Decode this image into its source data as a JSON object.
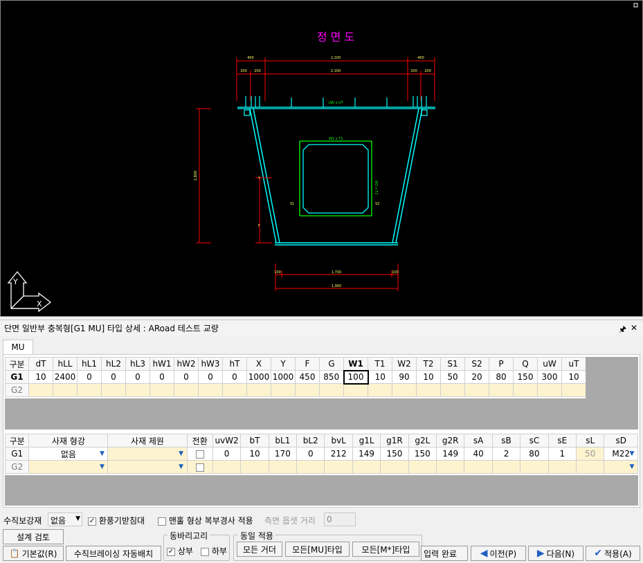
{
  "drawing": {
    "title": "정 면 도",
    "dims": {
      "top_left": "400",
      "top_mid": "2,100",
      "top_right": "400",
      "sub_left1": "200",
      "sub_left2": "200",
      "sub_mid": "2,100",
      "sub_right1": "200",
      "sub_right2": "200",
      "uw_ut": "UW x UT",
      "w1_t1": "W1 x T1",
      "w2_t2": "W2 x T2",
      "height": "2,800",
      "y": "Y",
      "f": "F",
      "s1": "S1",
      "s2": "S2",
      "bottom_inner": "1,700",
      "bottom_outer": "1,900",
      "bot_left": "100",
      "bot_right": "100"
    },
    "axis_y": "Y",
    "axis_x": "X",
    "colors": {
      "background": "#000000",
      "title": "#ff00ff",
      "dimension": "#ff0000",
      "girder": "#00ffff",
      "stiffener": "#00ff00",
      "text_dim": "#ffff00"
    }
  },
  "panel": {
    "title": "단면 일반부 충복형[G1 MU] 타입 상세 : ARoad 테스트 교량",
    "pin_icon": "pin-icon",
    "close_icon": "close-icon"
  },
  "tabs": {
    "mu": "MU"
  },
  "grid1": {
    "headers": [
      "구분",
      "dT",
      "hLL",
      "hL1",
      "hL2",
      "hL3",
      "hW1",
      "hW2",
      "hW3",
      "hT",
      "X",
      "Y",
      "F",
      "G",
      "W1",
      "T1",
      "W2",
      "T2",
      "S1",
      "S2",
      "P",
      "Q",
      "uW",
      "uT"
    ],
    "g1": [
      "G1",
      "10",
      "2400",
      "0",
      "0",
      "0",
      "0",
      "0",
      "0",
      "0",
      "1000",
      "1000",
      "450",
      "850",
      "100",
      "10",
      "90",
      "10",
      "50",
      "20",
      "80",
      "150",
      "300",
      "10"
    ],
    "g2": [
      "G2",
      "",
      "",
      "",
      "",
      "",
      "",
      "",
      "",
      "",
      "",
      "",
      "",
      "",
      "",
      "",
      "",
      "",
      "",
      "",
      "",
      "",
      "",
      ""
    ]
  },
  "grid2": {
    "headers": [
      "구분",
      "사재 형강",
      "사재 제원",
      "전환",
      "uvW2",
      "bT",
      "bL1",
      "bL2",
      "bvL",
      "g1L",
      "g1R",
      "g2L",
      "g2R",
      "sA",
      "sB",
      "sC",
      "sE",
      "sL",
      "sD"
    ],
    "g1": [
      "G1",
      "없음",
      "",
      "",
      "0",
      "10",
      "170",
      "0",
      "212",
      "149",
      "150",
      "150",
      "149",
      "40",
      "2",
      "80",
      "1",
      "50",
      "M22"
    ],
    "g2": [
      "G2",
      "",
      "",
      "",
      "",
      "",
      "",
      "",
      "",
      "",
      "",
      "",
      "",
      "",
      "",
      "",
      "",
      "",
      ""
    ]
  },
  "options": {
    "vertical_stiffener_label": "수직보강재",
    "vertical_stiffener_value": "없음",
    "eco_bearing_label": "환풍기받침대",
    "eco_bearing_checked": true,
    "hole_label": "맨홀 형상 복부경사 적용",
    "hole_checked": false,
    "side_offset_label": "측면 옵셋 거리",
    "side_offset_value": "0"
  },
  "buttons": {
    "design_review": "설계 검토",
    "defaults": "기본값(R)",
    "vertical_bracing": "수직브레이싱 자동배치",
    "copy_group_label": "동바리고리",
    "upper": "상부",
    "upper_checked": true,
    "lower": "하부",
    "lower_checked": false,
    "same_apply_label": "동일 적용",
    "all_girder": "모든 거더",
    "all_mu": "모든[MU]타입",
    "all_m": "모든[M*]타입",
    "input_done": "입력 완료",
    "prev": "이전(P)",
    "next": "다음(N)",
    "apply": "적용(A)"
  }
}
